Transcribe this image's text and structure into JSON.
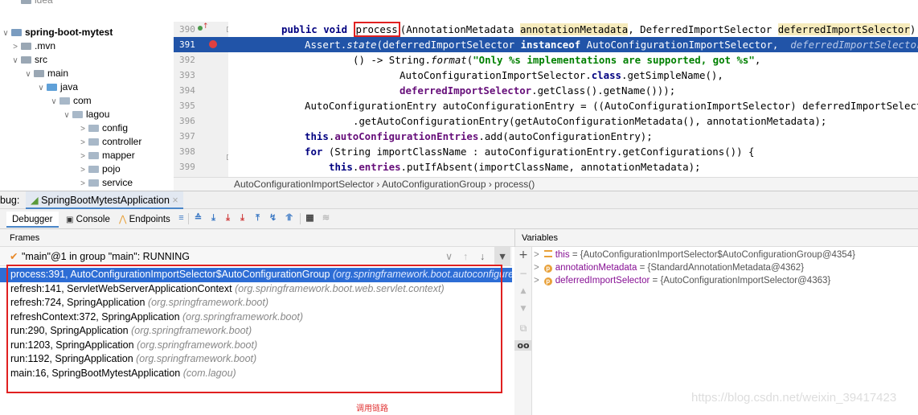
{
  "project_tree": {
    "items": [
      {
        "label": "idea",
        "arrow": "",
        "icon": "folder-icon"
      },
      {
        "label": "spring-boot-mytest",
        "arrow": "∨",
        "icon": "module-icon"
      },
      {
        "label": ".mvn",
        "arrow": ">",
        "icon": "folder-icon"
      },
      {
        "label": "src",
        "arrow": "∨",
        "icon": "folder-icon"
      },
      {
        "label": "main",
        "arrow": "∨",
        "icon": "folder-icon"
      },
      {
        "label": "java",
        "arrow": "∨",
        "icon": "source-folder-icon"
      },
      {
        "label": "com",
        "arrow": "∨",
        "icon": "package-icon"
      },
      {
        "label": "lagou",
        "arrow": "∨",
        "icon": "package-icon"
      },
      {
        "label": "config",
        "arrow": ">",
        "icon": "package-icon"
      },
      {
        "label": "controller",
        "arrow": ">",
        "icon": "package-icon"
      },
      {
        "label": "mapper",
        "arrow": ">",
        "icon": "package-icon"
      },
      {
        "label": "pojo",
        "arrow": ">",
        "icon": "package-icon"
      },
      {
        "label": "service",
        "arrow": ">",
        "icon": "package-icon"
      }
    ]
  },
  "editor": {
    "line_numbers": [
      "390",
      "391",
      "392",
      "393",
      "394",
      "395",
      "396",
      "397",
      "398",
      "399"
    ],
    "lines": {
      "l390_kw": "public void ",
      "l390_method": "process",
      "l390_a": "(AnnotationMetadata ",
      "l390_p1": "annotationMetadata",
      "l390_b": ", DeferredImportSelector ",
      "l390_p2": "deferredImportSelector",
      "l390_c": ") {",
      "l391_a": "Assert.",
      "l391_m": "state",
      "l391_b": "(deferredImportSelector ",
      "l391_kw": "instanceof",
      "l391_c": " AutoConfigurationImportSelector,  ",
      "l391_hint": "deferredImportSelector",
      "l392_a": "() -> String.",
      "l392_m": "format",
      "l392_b": "(",
      "l392_s": "\"Only %s implementations are supported, got %s\"",
      "l392_c": ",",
      "l393_a": "AutoConfigurationImportSelector.",
      "l393_kw": "class",
      "l393_b": ".getSimpleName(),",
      "l394_f": "deferredImportSelector",
      "l394_b": ".getClass().getName()));",
      "l395": "AutoConfigurationEntry autoConfigurationEntry = ((AutoConfigurationImportSelector) deferredImportSelector)",
      "l396": ".getAutoConfigurationEntry(getAutoConfigurationMetadata(), annotationMetadata);",
      "l397_kw": "this",
      "l397_dot": ".",
      "l397_f": "autoConfigurationEntries",
      "l397_b": ".add(autoConfigurationEntry);",
      "l398_kw": "for",
      "l398_b": " (String importClassName : autoConfigurationEntry.getConfigurations()) {",
      "l399_kw": "this",
      "l399_dot": ".",
      "l399_f": "entries",
      "l399_b": ".putIfAbsent(importClassName, annotationMetadata);"
    },
    "breadcrumb": "AutoConfigurationImportSelector  ›  AutoConfigurationGroup  ›  process()"
  },
  "debug": {
    "prefix": "bug:",
    "session_tab": "SpringBootMytestApplication",
    "tabs": [
      "Debugger",
      "Console",
      "Endpoints"
    ],
    "frames_header": "Frames",
    "variables_header": "Variables",
    "thread": "\"main\"@1 in group \"main\": RUNNING",
    "frames": [
      {
        "loc": "process:391, AutoConfigurationImportSelector$AutoConfigurationGroup ",
        "pkg": "(org.springframework.boot.autoconfigure)"
      },
      {
        "loc": "refresh:141, ServletWebServerApplicationContext ",
        "pkg": "(org.springframework.boot.web.servlet.context)"
      },
      {
        "loc": "refresh:724, SpringApplication ",
        "pkg": "(org.springframework.boot)"
      },
      {
        "loc": "refreshContext:372, SpringApplication ",
        "pkg": "(org.springframework.boot)"
      },
      {
        "loc": "run:290, SpringApplication ",
        "pkg": "(org.springframework.boot)"
      },
      {
        "loc": "run:1203, SpringApplication ",
        "pkg": "(org.springframework.boot)"
      },
      {
        "loc": "run:1192, SpringApplication ",
        "pkg": "(org.springframework.boot)"
      },
      {
        "loc": "main:16, SpringBootMytestApplication ",
        "pkg": "(com.lagou)"
      }
    ],
    "variables": [
      {
        "name": "this",
        "value": " = {AutoConfigurationImportSelector$AutoConfigurationGroup@4354}"
      },
      {
        "name": "annotationMetadata",
        "value": " = {StandardAnnotationMetadata@4362}"
      },
      {
        "name": "deferredImportSelector",
        "value": " = {AutoConfigurationImportSelector@4363}"
      }
    ],
    "annotation_caption": "调用链路"
  },
  "watermark": "https://blog.csdn.net/weixin_39417423"
}
